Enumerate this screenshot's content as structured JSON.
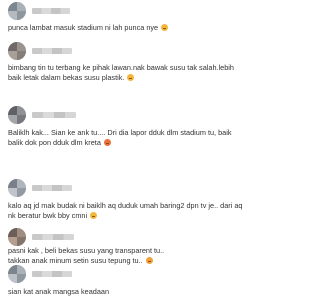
{
  "comments": [
    {
      "text": "punca lambat masuk stadium ni lah punca nye",
      "emoji": "laughing-face"
    },
    {
      "text": "bimbang tin tu terbang ke pihak lawan.nak bawak susu tak salah.lebih baik letak dalam bekas susu plastik.",
      "emoji": "thumbs-up"
    },
    {
      "text": "Baliklh kak... Sian ke ank tu.... Dri dia lapor dduk dlm stadium tu, baik balik dok pon dduk dlm kreta",
      "emoji": "frowning-face"
    },
    {
      "text": "kalo aq jd mak budak ni baiklh aq duduk umah baring2 dpn tv je.. dari aq nk beratur bwk bby cmni",
      "emoji": "smiling-face"
    },
    {
      "text": "pasni kak , beli bekas susu yang transparent tu..\ntakkan anak minum setin susu tepung tu..",
      "emoji": "smiling-face-hearts"
    },
    {
      "text": "sian kat anak mangsa keadaan",
      "emoji": ""
    }
  ]
}
